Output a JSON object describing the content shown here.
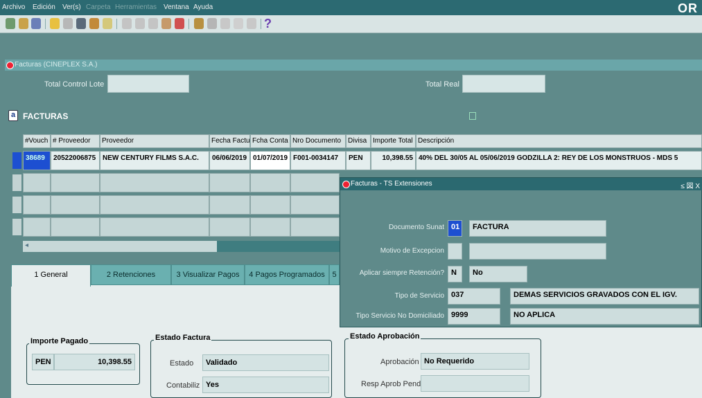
{
  "menu": {
    "items": [
      {
        "label": "Archivo",
        "enabled": true
      },
      {
        "label": "Edición",
        "enabled": true
      },
      {
        "label": "Ver(s)",
        "enabled": true
      },
      {
        "label": "Carpeta",
        "enabled": false
      },
      {
        "label": "Herramientas",
        "enabled": false
      },
      {
        "label": "Ventana",
        "enabled": true
      },
      {
        "label": "Ayuda",
        "enabled": true
      }
    ],
    "brand": "OR"
  },
  "toolbar": {
    "help_glyph": "?",
    "icons": [
      "new-icon",
      "find-icon",
      "navigator-icon",
      "folder-icon",
      "print-icon",
      "save-icon",
      "zoom-icon",
      "attachment-icon",
      "cut-icon",
      "copy-icon",
      "paste-icon",
      "edit-icon",
      "delete-icon",
      "pen-icon",
      "globe-icon",
      "window-icon",
      "translate-icon",
      "help-icon"
    ]
  },
  "window": {
    "title": "Facturas (CINEPLEX S.A.)",
    "total_control_lote_label": "Total Control Lote",
    "total_real_label": "Total Real",
    "section_title": "FACTURAS"
  },
  "grid": {
    "headers": [
      "#Vouch",
      "# Proveedor",
      "Proveedor",
      "Fecha Factu",
      "Fcha Conta",
      "Nro Documento",
      "Divisa",
      "Importe Total",
      "Descripción"
    ],
    "row": {
      "voucher": "38689",
      "proveedor_num": "20522006875",
      "proveedor": "NEW CENTURY FILMS S.A.C.",
      "fecha_factura": "06/06/2019",
      "fecha_conta": "01/07/2019",
      "nro_documento": "F001-0034147",
      "divisa": "PEN",
      "importe_total": "10,398.55",
      "descripcion": "40% DEL 30/05 AL 05/06/2019 GODZILLA 2: REY DE LOS MONSTRUOS - MDS 5"
    }
  },
  "tabs": [
    {
      "label": "1 General",
      "active": true
    },
    {
      "label": "2 Retenciones",
      "active": false
    },
    {
      "label": "3 Visualizar Pagos",
      "active": false
    },
    {
      "label": "4 Pagos Programados",
      "active": false
    },
    {
      "label": "5",
      "active": false
    }
  ],
  "importe_pagado": {
    "title": "Importe Pagado",
    "currency": "PEN",
    "amount": "10,398.55"
  },
  "estado_factura": {
    "title": "Estado Factura",
    "estado_label": "Estado",
    "estado_value": "Validado",
    "contabiliz_label": "Contabiliz",
    "contabiliz_value": "Yes"
  },
  "estado_aprobacion": {
    "title": "Estado Aprobación",
    "aprobacion_label": "Aprobación",
    "aprobacion_value": "No Requerido",
    "resp_label": "Resp Aprob Pend",
    "resp_value": ""
  },
  "popup": {
    "title": "Facturas - TS Extensiones",
    "controls": "≤ 図 X",
    "rows": [
      {
        "label": "Documento Sunat",
        "code": "01",
        "desc": "FACTURA"
      },
      {
        "label": "Motivo de Excepcion",
        "code": "",
        "desc": ""
      },
      {
        "label": "Aplicar siempre Retención?",
        "code": "N",
        "desc": "No"
      },
      {
        "label": "Tipo de Servicio",
        "code": "037",
        "desc": "DEMAS SERVICIOS GRAVADOS CON EL IGV."
      },
      {
        "label": "Tipo Servicio No Domiciliado",
        "code": "9999",
        "desc": "NO APLICA"
      }
    ]
  },
  "colors": {
    "titlebar": "#2b6970",
    "background": "#5f8a8a",
    "field": "#d7e6e6",
    "selected": "#1d4fd1"
  }
}
